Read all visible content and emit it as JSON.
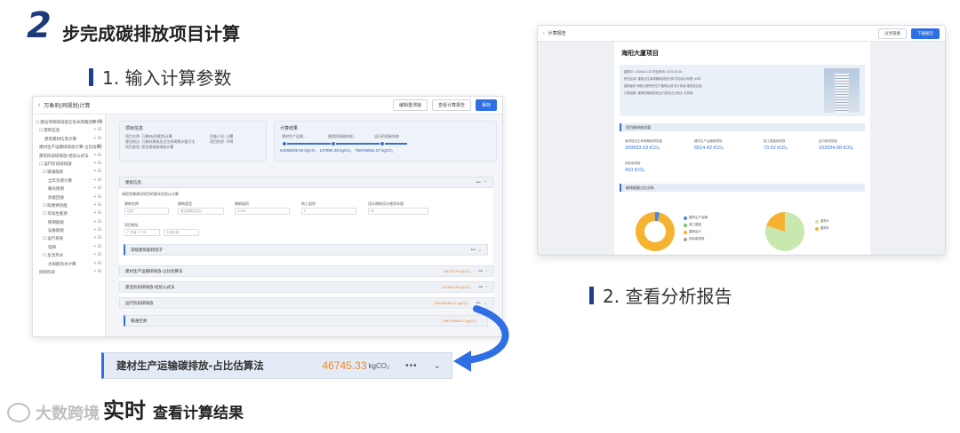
{
  "heading": {
    "num": "2",
    "title": "步完成碳排放项目计算"
  },
  "sub1": "1. 输入计算参数",
  "sub2": "2. 查看分析报告",
  "left_app": {
    "title": "万象府(同规划)计算",
    "buttons": [
      "编辑重测输",
      "查看计算报告",
      "保存"
    ],
    "tree": [
      "☐ 建设项目碳排放全生命周期测算计算",
      "☐ 建筑信息",
      "建筑建材信息计算",
      "建材生产运输碳排放计算-占比估算法",
      "建筑阶段碳排放-经验公式法",
      "☐ 运行阶段碳排放",
      "☐ 暖通能耗",
      "全年负荷计算",
      "暖光照明",
      "热能回收",
      "☐ 照明供热能",
      "☐ 可再生能源",
      "照明能耗",
      "设备能耗",
      "☐ 运行系统",
      "电梯",
      "☐ 生活热水",
      "太阳能热水计算",
      "拆除阶段"
    ],
    "info_card": {
      "title": "项目信息",
      "lines": [
        "项目名称: 万象府(同规划)计算",
        "建设地点: 万象府建筑及全生命周期计量方法",
        "项目类型: 居住建筑碳排放计算"
      ],
      "lines2": [
        "设施人员: 山翼",
        "项目性质: 不明"
      ]
    },
    "result_card": {
      "title": "计算结果",
      "labels": [
        "建材生产运输...",
        "建造阶段碳排放...",
        "运行阶段碳排放"
      ],
      "values": [
        "84258209.59 kgCO₂",
        "137895.38 kgCO₂",
        "758769584.07 kgCO₂"
      ]
    },
    "building_section": "建筑信息",
    "building_hint": "请您完善建设项目的基本信息以计算",
    "fields": [
      {
        "label": "建筑名称",
        "value": "住宅"
      },
      {
        "label": "建筑类型",
        "value": "居住建筑(住宅)"
      },
      {
        "label": "建筑面积",
        "value": "37262"
      },
      {
        "label": "地上面积",
        "value": "0"
      },
      {
        "label": "设计建筑设计使用年限",
        "value": "50"
      }
    ],
    "location_label": "项目地址",
    "location_values": [
      "广东省 / 广州...",
      "天河区域"
    ],
    "inner_section": "常规建筑能耗因子",
    "sections": [
      {
        "label": "建材生产运输碳排放-占比估算法",
        "value": "46745.33 kgCO₂"
      },
      {
        "label": "建造阶段碳排放-经验公式法",
        "value": "137895.38 kgCO₂"
      },
      {
        "label": "运行阶段碳排放",
        "value": "758769584.07 kgCO₂"
      }
    ],
    "sub_section": {
      "label": "暖通空调",
      "value": "758769584.07 kgCO₂"
    }
  },
  "zoom": {
    "label": "建材生产运输碳排放-占比估算法",
    "value": "46745.33",
    "unit": "kgCO₂",
    "more": "•••",
    "chevron": "⌄"
  },
  "realtime": {
    "bold": "实时",
    "rest": "查看计算结果"
  },
  "watermark": "大数跨境",
  "right_app": {
    "title": "计算报告",
    "buttons": [
      "分享链接",
      "下载报告"
    ],
    "project_name": "海阳大厦项目",
    "info_lines": [
      "建筑ID: 103466-3-18  项目时间: 2023-03-06",
      "所在区域: 建筑全生命周期碳排放计算  项目设计年限: 50年",
      "建筑面积 海阳大厦所在位于建筑区域 设计标准 碳排放总量",
      "计算结果: 建筑的碳排放在运行阶段占比较大 可持续"
    ],
    "summary_title": "项目碳排放总量",
    "stats": [
      {
        "label": "碳排放全生命周期碳排放量",
        "value": "169933.03 tCO₂"
      },
      {
        "label": "建材生产运输碳排放",
        "value": "6514.42 tCO₂"
      },
      {
        "label": "施工建造碳排放",
        "value": "73.62 tCO₂"
      },
      {
        "label": "运行碳排放量",
        "value": "102934.98 tCO₂"
      },
      {
        "label": "拆除碳排放",
        "value": "410 tCO₂"
      }
    ],
    "chart_title": "碳排放量占比分析",
    "legend1": [
      "建材生产运输",
      "施工建造",
      "建筑运行",
      "拆除碳排放"
    ],
    "legend2": [
      "建材A",
      "建材B"
    ],
    "colors": {
      "orange": "#f5b331",
      "blue": "#4f86d6",
      "green": "#7ac46b",
      "lightgreen": "#c9e8b0"
    }
  },
  "chart_data": [
    {
      "type": "pie",
      "title": "",
      "categories": [
        "建材生产运输",
        "施工建造",
        "建筑运行",
        "拆除碳排放"
      ],
      "values": [
        3.8,
        0.1,
        95.8,
        0.3
      ]
    },
    {
      "type": "pie",
      "title": "",
      "categories": [
        "建材A",
        "建材B"
      ],
      "values": [
        80,
        20
      ]
    }
  ]
}
